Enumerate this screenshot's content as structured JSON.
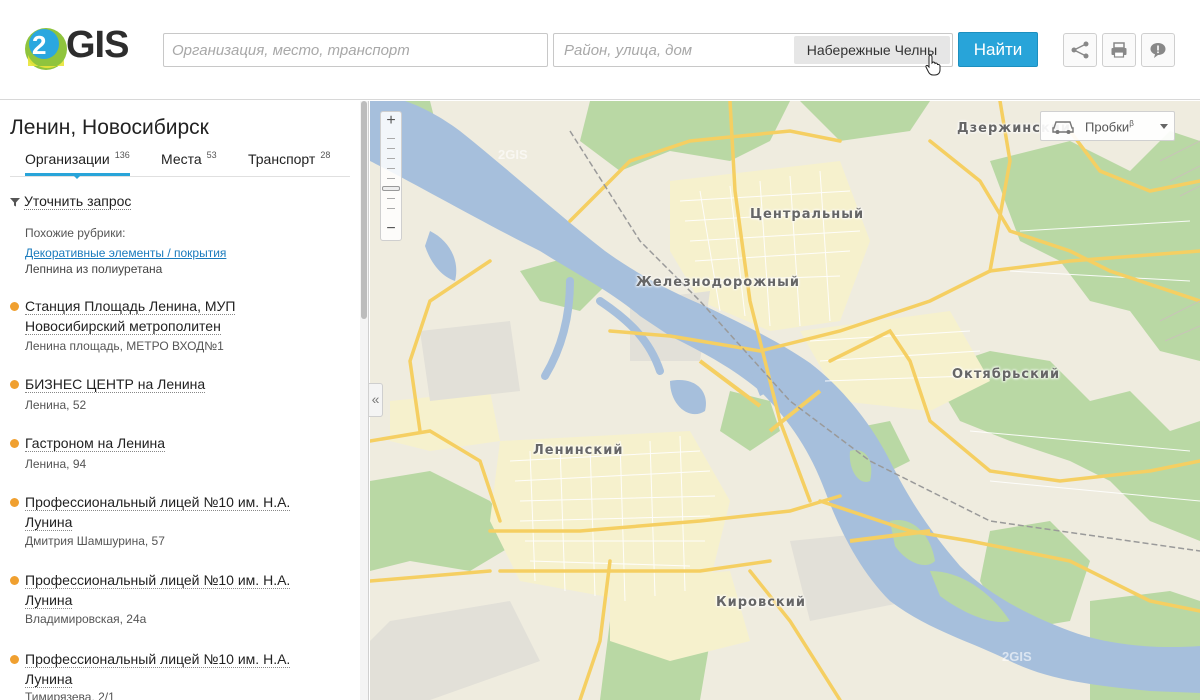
{
  "header": {
    "logo": {
      "digit": "2",
      "word": "GIS"
    },
    "search_what_placeholder": "Организация, место, транспорт",
    "search_where_placeholder": "Район, улица, дом",
    "city": "Набережные Челны",
    "find_label": "Найти",
    "icons": [
      "route-icon",
      "print-icon",
      "feedback-icon"
    ]
  },
  "sidebar": {
    "title": "Ленин, Новосибирск",
    "tabs": [
      {
        "label": "Организации",
        "count": "136"
      },
      {
        "label": "Места",
        "count": "53"
      },
      {
        "label": "Транспорт",
        "count": "28"
      }
    ],
    "refine_label": "Уточнить запрос",
    "similar_label": "Похожие рубрики:",
    "similar_link": "Декоративные элементы / покрытия",
    "similar_sub": "Лепнина из полиуретана",
    "results": [
      {
        "name": "Станция Площадь Ленина, МУП Новосибирский метрополитен",
        "address": "Ленина площадь, МЕТРО ВХОД№1"
      },
      {
        "name": "БИЗНЕС ЦЕНТР на Ленина",
        "address": "Ленина, 52"
      },
      {
        "name": "Гастроном на Ленина",
        "address": "Ленина, 94"
      },
      {
        "name": "Профессиональный лицей №10 им. Н.А. Лунина",
        "address": "Дмитрия Шамшурина, 57"
      },
      {
        "name": "Профессиональный лицей №10 им. Н.А. Лунина",
        "address": "Владимировская, 24а"
      },
      {
        "name": "Профессиональный лицей №10 им. Н.А. Лунина",
        "address": "Тимирязева, 2/1"
      }
    ],
    "collapse_label": "«"
  },
  "map": {
    "traffic_label": "Пробки",
    "traffic_beta": "β",
    "zoom_in": "+",
    "zoom_out": "−",
    "watermark": "2GIS",
    "districts": [
      {
        "name": "Центральный"
      },
      {
        "name": "Железнодорожный"
      },
      {
        "name": "Октябрьский"
      },
      {
        "name": "Ленинский"
      },
      {
        "name": "Кировский"
      },
      {
        "name": "Дзержинский"
      }
    ],
    "colors": {
      "water": "#a6bfdc",
      "park": "#b9d8a4",
      "road": "#f5cf62",
      "urban": "#efecdf",
      "blocks": "#f6f1cd"
    }
  }
}
